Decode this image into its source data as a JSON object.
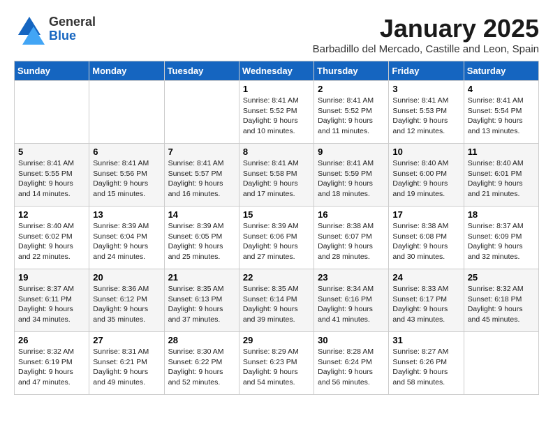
{
  "header": {
    "logo_general": "General",
    "logo_blue": "Blue",
    "title": "January 2025",
    "location": "Barbadillo del Mercado, Castille and Leon, Spain"
  },
  "days_of_week": [
    "Sunday",
    "Monday",
    "Tuesday",
    "Wednesday",
    "Thursday",
    "Friday",
    "Saturday"
  ],
  "weeks": [
    [
      {
        "day": "",
        "info": ""
      },
      {
        "day": "",
        "info": ""
      },
      {
        "day": "",
        "info": ""
      },
      {
        "day": "1",
        "info": "Sunrise: 8:41 AM\nSunset: 5:52 PM\nDaylight: 9 hours\nand 10 minutes."
      },
      {
        "day": "2",
        "info": "Sunrise: 8:41 AM\nSunset: 5:52 PM\nDaylight: 9 hours\nand 11 minutes."
      },
      {
        "day": "3",
        "info": "Sunrise: 8:41 AM\nSunset: 5:53 PM\nDaylight: 9 hours\nand 12 minutes."
      },
      {
        "day": "4",
        "info": "Sunrise: 8:41 AM\nSunset: 5:54 PM\nDaylight: 9 hours\nand 13 minutes."
      }
    ],
    [
      {
        "day": "5",
        "info": "Sunrise: 8:41 AM\nSunset: 5:55 PM\nDaylight: 9 hours\nand 14 minutes."
      },
      {
        "day": "6",
        "info": "Sunrise: 8:41 AM\nSunset: 5:56 PM\nDaylight: 9 hours\nand 15 minutes."
      },
      {
        "day": "7",
        "info": "Sunrise: 8:41 AM\nSunset: 5:57 PM\nDaylight: 9 hours\nand 16 minutes."
      },
      {
        "day": "8",
        "info": "Sunrise: 8:41 AM\nSunset: 5:58 PM\nDaylight: 9 hours\nand 17 minutes."
      },
      {
        "day": "9",
        "info": "Sunrise: 8:41 AM\nSunset: 5:59 PM\nDaylight: 9 hours\nand 18 minutes."
      },
      {
        "day": "10",
        "info": "Sunrise: 8:40 AM\nSunset: 6:00 PM\nDaylight: 9 hours\nand 19 minutes."
      },
      {
        "day": "11",
        "info": "Sunrise: 8:40 AM\nSunset: 6:01 PM\nDaylight: 9 hours\nand 21 minutes."
      }
    ],
    [
      {
        "day": "12",
        "info": "Sunrise: 8:40 AM\nSunset: 6:02 PM\nDaylight: 9 hours\nand 22 minutes."
      },
      {
        "day": "13",
        "info": "Sunrise: 8:39 AM\nSunset: 6:04 PM\nDaylight: 9 hours\nand 24 minutes."
      },
      {
        "day": "14",
        "info": "Sunrise: 8:39 AM\nSunset: 6:05 PM\nDaylight: 9 hours\nand 25 minutes."
      },
      {
        "day": "15",
        "info": "Sunrise: 8:39 AM\nSunset: 6:06 PM\nDaylight: 9 hours\nand 27 minutes."
      },
      {
        "day": "16",
        "info": "Sunrise: 8:38 AM\nSunset: 6:07 PM\nDaylight: 9 hours\nand 28 minutes."
      },
      {
        "day": "17",
        "info": "Sunrise: 8:38 AM\nSunset: 6:08 PM\nDaylight: 9 hours\nand 30 minutes."
      },
      {
        "day": "18",
        "info": "Sunrise: 8:37 AM\nSunset: 6:09 PM\nDaylight: 9 hours\nand 32 minutes."
      }
    ],
    [
      {
        "day": "19",
        "info": "Sunrise: 8:37 AM\nSunset: 6:11 PM\nDaylight: 9 hours\nand 34 minutes."
      },
      {
        "day": "20",
        "info": "Sunrise: 8:36 AM\nSunset: 6:12 PM\nDaylight: 9 hours\nand 35 minutes."
      },
      {
        "day": "21",
        "info": "Sunrise: 8:35 AM\nSunset: 6:13 PM\nDaylight: 9 hours\nand 37 minutes."
      },
      {
        "day": "22",
        "info": "Sunrise: 8:35 AM\nSunset: 6:14 PM\nDaylight: 9 hours\nand 39 minutes."
      },
      {
        "day": "23",
        "info": "Sunrise: 8:34 AM\nSunset: 6:16 PM\nDaylight: 9 hours\nand 41 minutes."
      },
      {
        "day": "24",
        "info": "Sunrise: 8:33 AM\nSunset: 6:17 PM\nDaylight: 9 hours\nand 43 minutes."
      },
      {
        "day": "25",
        "info": "Sunrise: 8:32 AM\nSunset: 6:18 PM\nDaylight: 9 hours\nand 45 minutes."
      }
    ],
    [
      {
        "day": "26",
        "info": "Sunrise: 8:32 AM\nSunset: 6:19 PM\nDaylight: 9 hours\nand 47 minutes."
      },
      {
        "day": "27",
        "info": "Sunrise: 8:31 AM\nSunset: 6:21 PM\nDaylight: 9 hours\nand 49 minutes."
      },
      {
        "day": "28",
        "info": "Sunrise: 8:30 AM\nSunset: 6:22 PM\nDaylight: 9 hours\nand 52 minutes."
      },
      {
        "day": "29",
        "info": "Sunrise: 8:29 AM\nSunset: 6:23 PM\nDaylight: 9 hours\nand 54 minutes."
      },
      {
        "day": "30",
        "info": "Sunrise: 8:28 AM\nSunset: 6:24 PM\nDaylight: 9 hours\nand 56 minutes."
      },
      {
        "day": "31",
        "info": "Sunrise: 8:27 AM\nSunset: 6:26 PM\nDaylight: 9 hours\nand 58 minutes."
      },
      {
        "day": "",
        "info": ""
      }
    ]
  ]
}
